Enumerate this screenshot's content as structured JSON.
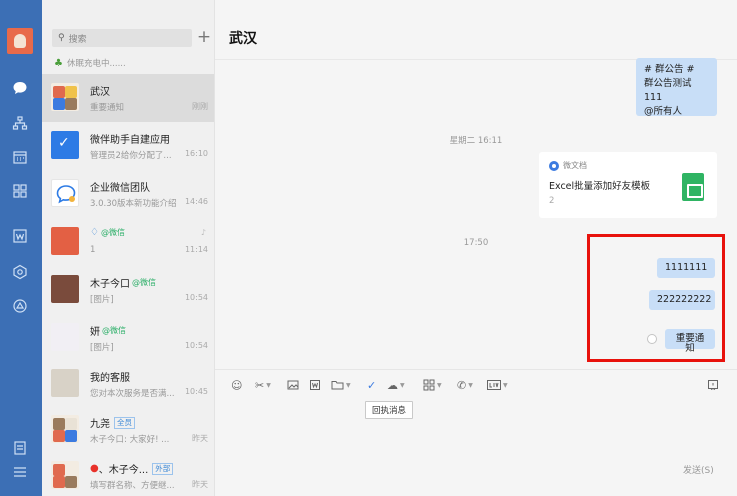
{
  "rail": {
    "icons": [
      "chat-icon",
      "contacts-icon",
      "calendar-icon",
      "apps-icon",
      "docs-icon",
      "workbench-icon",
      "drive-icon",
      "notes-icon",
      "menu-icon"
    ]
  },
  "list": {
    "search_placeholder": "搜索",
    "charging_text": "休眠充电中......",
    "conversations": [
      {
        "name": "武汉",
        "preview": "重要通知",
        "time": "刚刚"
      },
      {
        "name": "微伴助手自建应用",
        "preview": "管理员2给你分配了...",
        "time": "16:10"
      },
      {
        "name": "企业微信团队",
        "preview": "3.0.30版本新功能介绍",
        "time": "14:46"
      },
      {
        "name": "",
        "tag": "@微信",
        "preview": "1",
        "time": "11:14"
      },
      {
        "name": "木子今口",
        "tag": "@微信",
        "preview": "[图片]",
        "time": "10:54"
      },
      {
        "name": "妍",
        "tag": "@微信",
        "preview": "[图片]",
        "time": "10:54"
      },
      {
        "name": "我的客服",
        "preview": "您对本次服务是否满...",
        "time": "10:45"
      },
      {
        "name": "九尧",
        "badge": "全员",
        "preview": "木子今口: 大家好! ...",
        "time": "昨天"
      },
      {
        "name": "、木子今...",
        "badge": "外部",
        "preview": "填写群名称、方便继...",
        "time": "昨天"
      }
    ]
  },
  "chat": {
    "title": "武汉",
    "notice_lines": [
      "# 群公告 #",
      "群公告测试111",
      "@所有人"
    ],
    "time1": "星期二 16:11",
    "doc_source": "微文档",
    "doc_title": "Excel批量添加好友模板",
    "doc_count": "2",
    "time2": "17:50",
    "messages": [
      "1111111",
      "222222222",
      "重要通知"
    ],
    "tooltip": "回执消息",
    "send_label": "发送(S)"
  }
}
